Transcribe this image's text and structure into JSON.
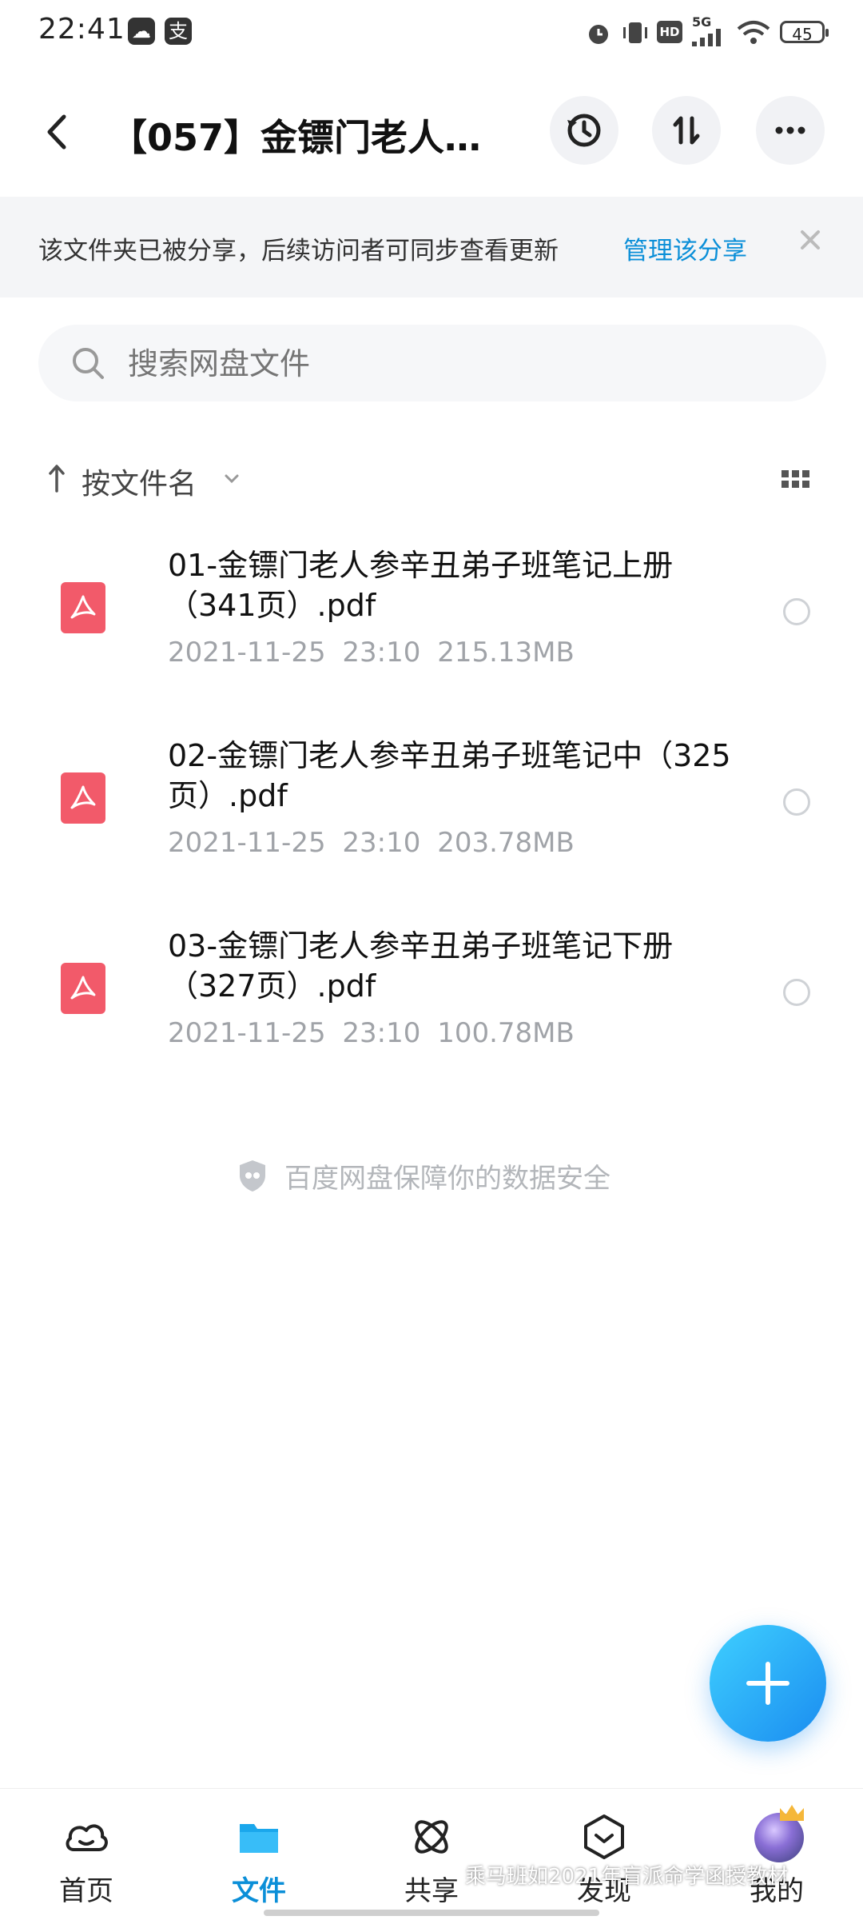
{
  "status_bar": {
    "time": "22:41",
    "app_icons": [
      "gallery-icon",
      "alipay-icon"
    ],
    "app_icon_glyphs": [
      "☁",
      "支"
    ],
    "network": "5G",
    "hd": "HD",
    "battery": "45"
  },
  "header": {
    "title": "【057】金镖门老人…",
    "actions": [
      "history-icon",
      "transfer-icon",
      "more-icon"
    ]
  },
  "share_banner": {
    "text": "该文件夹已被分享，后续访问者可同步查看更新",
    "link": "管理该分享"
  },
  "search": {
    "placeholder": "搜索网盘文件"
  },
  "sort": {
    "label": "按文件名"
  },
  "files": [
    {
      "name": "01-金镖门老人参辛丑弟子班笔记上册（341页）.pdf",
      "date": "2021-11-25",
      "time": "23:10",
      "size": "215.13MB"
    },
    {
      "name": "02-金镖门老人参辛丑弟子班笔记中（325页）.pdf",
      "date": "2021-11-25",
      "time": "23:10",
      "size": "203.78MB"
    },
    {
      "name": "03-金镖门老人参辛丑弟子班笔记下册（327页）.pdf",
      "date": "2021-11-25",
      "time": "23:10",
      "size": "100.78MB"
    }
  ],
  "safety": {
    "text": "百度网盘保障你的数据安全"
  },
  "bottom_nav": {
    "items": [
      {
        "label": "首页",
        "icon": "cloud-icon"
      },
      {
        "label": "文件",
        "icon": "folder-icon"
      },
      {
        "label": "共享",
        "icon": "share-atom-icon"
      },
      {
        "label": "发现",
        "icon": "discover-icon"
      },
      {
        "label": "我的",
        "icon": "avatar"
      }
    ],
    "active": "文件"
  },
  "watermark": "乘马班如2021年盲派命学函授教材",
  "colors": {
    "accent": "#0b8fd8",
    "pdf": "#f25a6a",
    "fab_start": "#3fd0ff",
    "fab_end": "#1a8cf0"
  }
}
